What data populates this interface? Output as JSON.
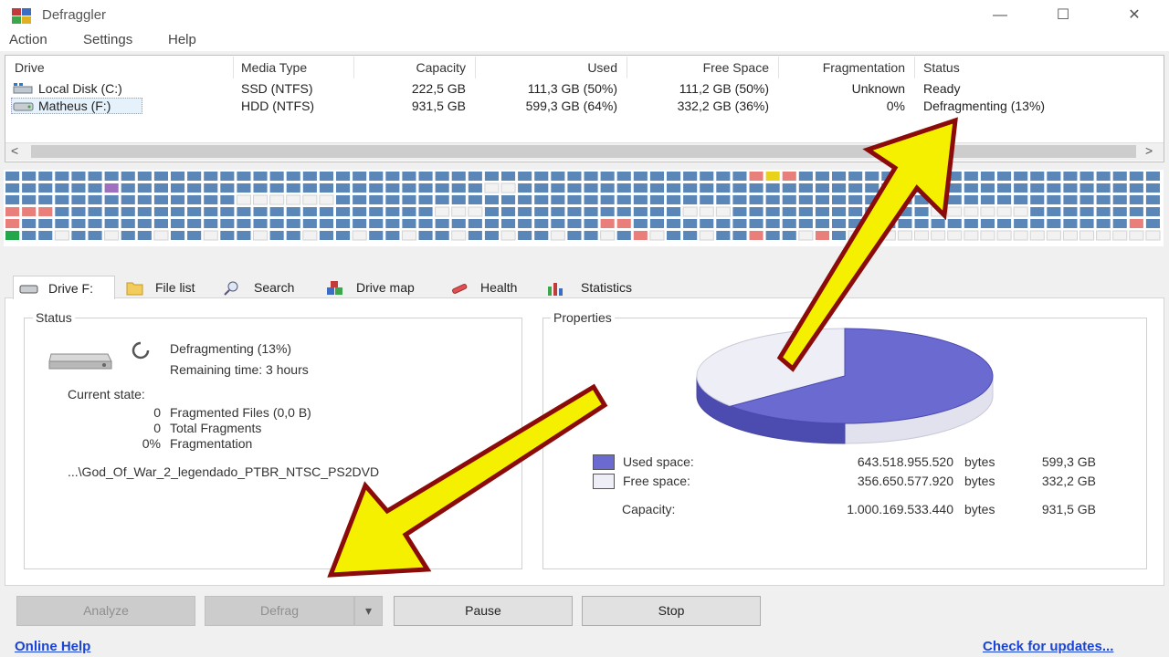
{
  "window": {
    "title": "Defraggler",
    "minimize": "—",
    "maximize": "☐",
    "close": "✕"
  },
  "menu": [
    "Action",
    "Settings",
    "Help"
  ],
  "drives": {
    "columns": [
      "Drive",
      "Media Type",
      "Capacity",
      "Used",
      "Free Space",
      "Fragmentation",
      "Status"
    ],
    "rows": [
      {
        "drive": "Local Disk (C:)",
        "media": "SSD (NTFS)",
        "capacity": "222,5 GB",
        "used": "111,3 GB (50%)",
        "free": "111,2 GB (50%)",
        "fragmentation": "Unknown",
        "status": "Ready"
      },
      {
        "drive": "Matheus (F:)",
        "media": "HDD (NTFS)",
        "capacity": "931,5 GB",
        "used": "599,3 GB (64%)",
        "free": "332,2 GB (36%)",
        "fragmentation": "0%",
        "status": "Defragmenting (13%)"
      }
    ],
    "scroll_left": "<",
    "scroll_right": ">"
  },
  "block_map": {
    "colors": {
      "used": "#5b86b8",
      "free": "#f2f2f2",
      "fragmented": "#e87f7a",
      "processing": "#e8d21a",
      "system": "#a070c0",
      "current": "#22a84a"
    }
  },
  "tabs": [
    "Drive F:",
    "File list",
    "Search",
    "Drive map",
    "Health",
    "Statistics"
  ],
  "status_panel": {
    "title": "Status",
    "state_line": "Defragmenting (13%)",
    "remaining": "Remaining time: 3 hours",
    "current_state_label": "Current state:",
    "fragmented_files_value": "0",
    "fragmented_files_label": "Fragmented Files (0,0 B)",
    "total_fragments_value": "0",
    "total_fragments_label": "Total Fragments",
    "fragmentation_value": "0%",
    "fragmentation_label": "Fragmentation",
    "current_file": "...\\God_Of_War_2_legendado_PTBR_NTSC_PS2DVD"
  },
  "properties_panel": {
    "title": "Properties",
    "used_pct": 64,
    "used_label": "Used space:",
    "used_bytes": "643.518.955.520",
    "used_gb": "599,3 GB",
    "free_label": "Free space:",
    "free_bytes": "356.650.577.920",
    "free_gb": "332,2 GB",
    "capacity_label": "Capacity:",
    "capacity_bytes": "1.000.169.533.440",
    "capacity_gb": "931,5 GB",
    "bytes_unit": "bytes",
    "used_color": "#6a6ad0",
    "free_color": "#eeeef6"
  },
  "buttons": {
    "analyze": "Analyze",
    "defrag": "Defrag",
    "dropdown": "▾",
    "pause": "Pause",
    "stop": "Stop"
  },
  "footer": {
    "online_help": "Online Help",
    "check_updates": "Check for updates..."
  },
  "annotation_colors": {
    "arrow_fill": "#f5f000",
    "arrow_stroke": "#8b0a0a"
  }
}
